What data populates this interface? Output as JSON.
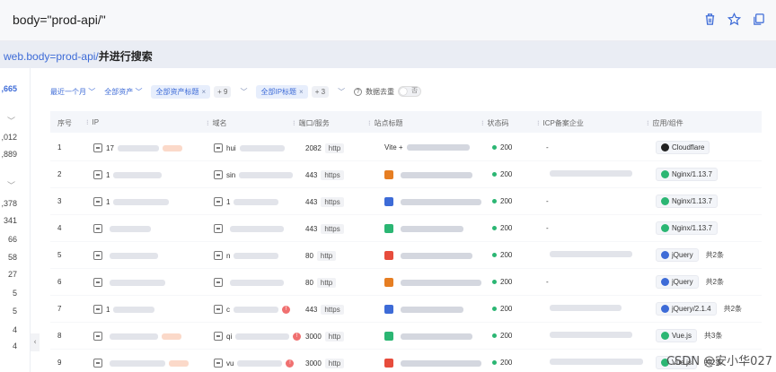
{
  "search": {
    "query": "body=\"prod-api/\""
  },
  "hint": {
    "link": "web.body=prod-api/",
    "rest": "并进行搜索"
  },
  "left_counts": [
    ",665",
    ",012",
    ",889",
    ",378",
    "341",
    "66",
    "58",
    "27",
    "5",
    "5",
    "4",
    "4"
  ],
  "filters": {
    "time": "最近一个月",
    "assets": "全部资产",
    "tag1": "全部资产标题",
    "tag1_more": "+ 9",
    "tag2": "全部IP标题",
    "tag2_more": "+ 3",
    "dedupe_label": "数据去重",
    "toggle_label": "否"
  },
  "columns": [
    "序号",
    "IP",
    "域名",
    "端口/服务",
    "站点标题",
    "状态码",
    "ICP备案企业",
    "应用/组件"
  ],
  "rows": [
    {
      "no": "1",
      "ip": "17",
      "domain": "hui",
      "port": "2082",
      "proto": "http",
      "title": "Vite +",
      "status": "200",
      "icp": "-",
      "app": "Cloudflare",
      "app_color": "#222222",
      "more": ""
    },
    {
      "no": "2",
      "ip": "1",
      "domain": "sin",
      "port": "443",
      "proto": "https",
      "title": "",
      "status": "200",
      "icp": "",
      "app": "Nginx/1.13.7",
      "app_color": "#2bb673",
      "more": ""
    },
    {
      "no": "3",
      "ip": "1",
      "domain": "1",
      "port": "443",
      "proto": "https",
      "title": "",
      "status": "200",
      "icp": "-",
      "app": "Nginx/1.13.7",
      "app_color": "#2bb673",
      "more": ""
    },
    {
      "no": "4",
      "ip": "",
      "domain": "",
      "port": "443",
      "proto": "https",
      "title": "",
      "status": "200",
      "icp": "-",
      "app": "Nginx/1.13.7",
      "app_color": "#2bb673",
      "more": ""
    },
    {
      "no": "5",
      "ip": "",
      "domain": "n",
      "port": "80",
      "proto": "http",
      "title": "",
      "status": "200",
      "icp": "",
      "app": "jQuery",
      "app_color": "#3d6bd7",
      "more": "共2条"
    },
    {
      "no": "6",
      "ip": "",
      "domain": "",
      "port": "80",
      "proto": "http",
      "title": "",
      "status": "200",
      "icp": "-",
      "app": "jQuery",
      "app_color": "#3d6bd7",
      "more": "共2条"
    },
    {
      "no": "7",
      "ip": "1",
      "domain": "c",
      "port": "443",
      "proto": "https",
      "title": "",
      "status": "200",
      "icp": "",
      "app": "jQuery/2.1.4",
      "app_color": "#3d6bd7",
      "more": "共2条"
    },
    {
      "no": "8",
      "ip": "",
      "domain": "qi",
      "port": "3000",
      "proto": "http",
      "title": "",
      "status": "200",
      "icp": "",
      "app": "Vue.js",
      "app_color": "#2bb673",
      "more": "共3条"
    },
    {
      "no": "9",
      "ip": "",
      "domain": "vu",
      "port": "3000",
      "proto": "http",
      "title": "",
      "status": "200",
      "icp": "",
      "app": "Vue.js",
      "app_color": "#2bb673",
      "more": "共2条"
    }
  ],
  "watermark": "CSDN @安小华027"
}
